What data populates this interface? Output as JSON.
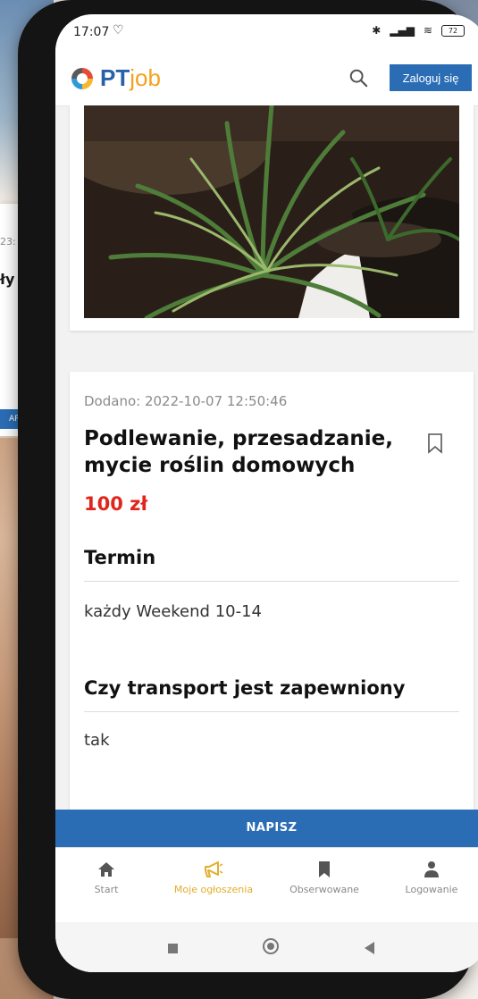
{
  "background": {
    "card_time": "23:",
    "card_title": "ły",
    "card_button": "APIS"
  },
  "status_bar": {
    "time": "17:07",
    "heart_icon": "heart-outline-icon",
    "battery": "72"
  },
  "header": {
    "logo_pt": "PT",
    "logo_job": "job",
    "login_label": "Zaloguj się"
  },
  "listing": {
    "added": "Dodano: 2022-10-07 12:50:46",
    "title": "Podlewanie, przesadzanie, mycie roślin domowych",
    "price": "100 zł",
    "sections": [
      {
        "heading": "Termin",
        "value": "każdy Weekend 10-14"
      },
      {
        "heading": "Czy transport jest zapewniony",
        "value": "tak"
      }
    ]
  },
  "write_button": "NAPISZ",
  "bottom_nav": [
    {
      "label": "Start",
      "icon": "home-icon",
      "active": false
    },
    {
      "label": "Moje ogłoszenia",
      "icon": "megaphone-icon",
      "active": true
    },
    {
      "label": "Obserwowane",
      "icon": "bookmark-icon",
      "active": false
    },
    {
      "label": "Logowanie",
      "icon": "person-icon",
      "active": false
    }
  ],
  "colors": {
    "brand_blue": "#2b6db5",
    "price_red": "#e0251b",
    "active_nav": "#e3ad2a"
  }
}
